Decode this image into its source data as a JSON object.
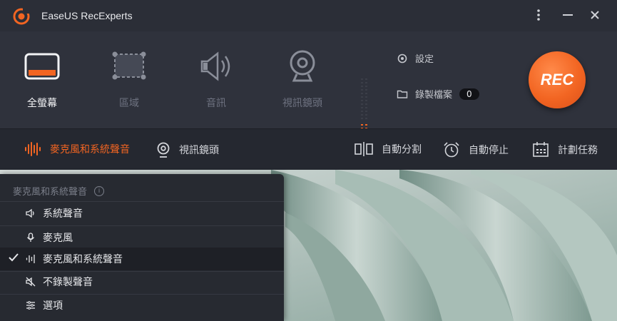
{
  "app": {
    "title": "EaseUS RecExperts"
  },
  "modes": [
    {
      "label": "全螢幕",
      "icon": "fullscreen-icon",
      "active": true
    },
    {
      "label": "區域",
      "icon": "region-icon",
      "active": false
    },
    {
      "label": "音訊",
      "icon": "speaker-icon",
      "active": false
    },
    {
      "label": "視訊鏡頭",
      "icon": "webcam-icon",
      "active": false
    }
  ],
  "side": {
    "settings_label": "設定",
    "recordings_label": "錄製檔案",
    "recordings_count": "0"
  },
  "rec_label": "REC",
  "options": {
    "audio_label": "麥克風和系統聲音",
    "webcam_label": "視訊鏡頭",
    "auto_split_label": "自動分割",
    "auto_stop_label": "自動停止",
    "schedule_label": "計劃任務"
  },
  "dropdown": {
    "header": "麥克風和系統聲音",
    "items": [
      {
        "label": "系統聲音",
        "icon": "speaker-icon",
        "selected": false
      },
      {
        "label": "麥克風",
        "icon": "microphone-icon",
        "selected": false
      },
      {
        "label": "麥克風和系統聲音",
        "icon": "audio-wave-icon",
        "selected": true
      },
      {
        "label": "不錄製聲音",
        "icon": "mute-icon",
        "selected": false
      },
      {
        "label": "選項",
        "icon": "options-icon",
        "selected": false
      }
    ]
  },
  "colors": {
    "accent": "#f26522",
    "window_bg": "#2b2e37",
    "toolbar_bg": "#2f323c"
  }
}
